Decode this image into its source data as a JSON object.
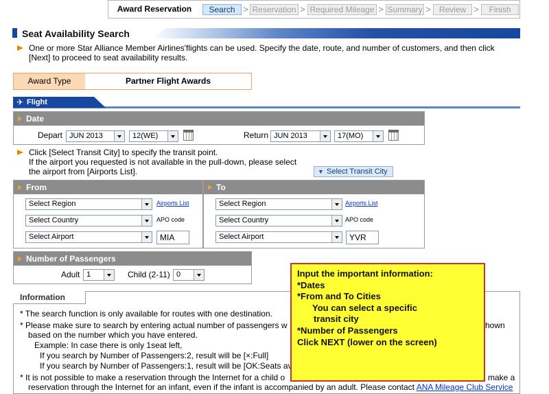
{
  "steps": {
    "label": "Award Reservation",
    "items": [
      "Search",
      "Reservation",
      "Required Mileage",
      "Summary",
      "Review",
      "Finish"
    ],
    "arrow": ">"
  },
  "section": {
    "title": "Seat Availability Search",
    "intro": "One or more Star Alliance Member Airlines'flights can be used. Specify the date, route, and number of customers, and then click [Next] to proceed to seat availability results."
  },
  "award": {
    "label": "Award Type",
    "value": "Partner Flight Awards"
  },
  "flight": {
    "tab_label": "Flight",
    "plane_icon": "airplane-icon"
  },
  "date": {
    "header": "Date",
    "depart_label": "Depart",
    "depart_month": "JUN 2013",
    "depart_day": "12(WE)",
    "return_label": "Return",
    "return_month": "JUN 2013",
    "return_day": "17(MO)"
  },
  "transit": {
    "line1": "Click [Select Transit City] to specify the transit point.",
    "line2": "If the airport you requested is not available in the pull-down, please select",
    "line3": "the airport from [Airports List].",
    "button": "Select Transit City"
  },
  "from": {
    "header": "From",
    "region": "Select Region",
    "country": "Select Country",
    "airport": "Select Airport",
    "airports_list": "Airports List",
    "apo_label": "APO code",
    "code": "MIA"
  },
  "to": {
    "header": "To",
    "region": "Select Region",
    "country": "Select Country",
    "airport": "Select Airport",
    "airports_list": "Airports List",
    "apo_label": "APO code",
    "code": "YVR"
  },
  "passengers": {
    "header": "Number of Passengers",
    "adult_label": "Adult",
    "adult_value": "1",
    "child_label": "Child (2-11)",
    "child_value": "0"
  },
  "information": {
    "tab": "Information",
    "l1": "*  The search function is only available for routes with one destination.",
    "l2a": "*  Please make sure to search by entering actual number of passengers w",
    "l2b": "hown",
    "l3": "based on the number which you have entered.",
    "l4": "Example: In case there is only 1seat left,",
    "l5": "If you search by Number of Passengers:2, result will be [×:Full]",
    "l6": "If you search by Number of Passengers:1, result will be [OK:Seats av",
    "l7a": "*  It is not possible to make a reservation through the Internet for a child o",
    "l7b": "make a",
    "l8a": "reservation through the Internet for an infant, even if the infant is accompanied by an adult. Please contact ",
    "l8_link": "ANA Mileage Club Service"
  },
  "callout": {
    "l1": "Input the important information:",
    "l2": "*Dates",
    "l3": "*From and To Cities",
    "l4": "You can select a specific",
    "l5": "transit city",
    "l6": "*Number of Passengers",
    "l7": "Click NEXT (lower on the screen)"
  },
  "colors": {
    "accent_blue": "#17479e",
    "panel_header_gray": "#8c8c8c",
    "bullet_orange": "#e48a00",
    "callout_yellow": "#ffff33",
    "callout_border": "#c9342c"
  }
}
